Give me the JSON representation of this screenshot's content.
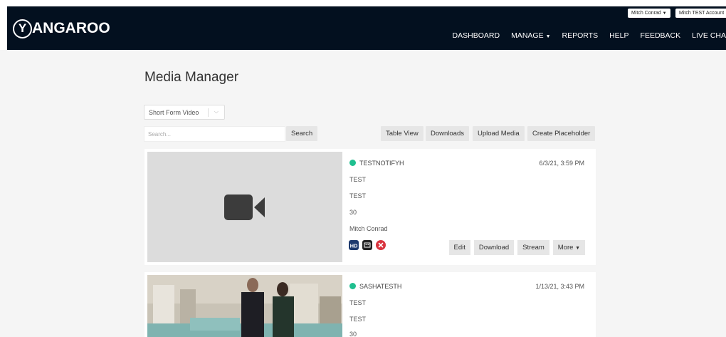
{
  "header": {
    "logo_text": "ANGAROO",
    "logo_letter": "Y",
    "user_menu": "Mitch Conrad",
    "account_menu": "Mitch TEST Account",
    "nav": [
      "DASHBOARD",
      "MANAGE",
      "REPORTS",
      "HELP",
      "FEEDBACK",
      "LIVE CHA"
    ]
  },
  "page": {
    "title": "Media Manager",
    "category_select": "Short Form Video",
    "search_placeholder": "Search...",
    "search_button": "Search",
    "toolbar": {
      "table_view": "Table View",
      "downloads": "Downloads",
      "upload_media": "Upload Media",
      "create_placeholder": "Create Placeholder"
    }
  },
  "media": [
    {
      "title": "TESTNOTIFYH",
      "date": "6/3/21, 3:59 PM",
      "line1": "TEST",
      "line2": "TEST",
      "line3": "30",
      "owner": "Mitch Conrad",
      "badges": [
        "HD",
        "caption",
        "error"
      ],
      "actions": {
        "edit": "Edit",
        "download": "Download",
        "stream": "Stream",
        "more": "More"
      }
    },
    {
      "title": "SASHATESTH",
      "date": "1/13/21, 3:43 PM",
      "line1": "TEST",
      "line2": "TEST",
      "line3": "30"
    }
  ],
  "colors": {
    "header_bg": "#03101f",
    "status_green": "#1fbf8f",
    "page_bg": "#f5f5f5",
    "button_bg": "#e6e6e6"
  }
}
